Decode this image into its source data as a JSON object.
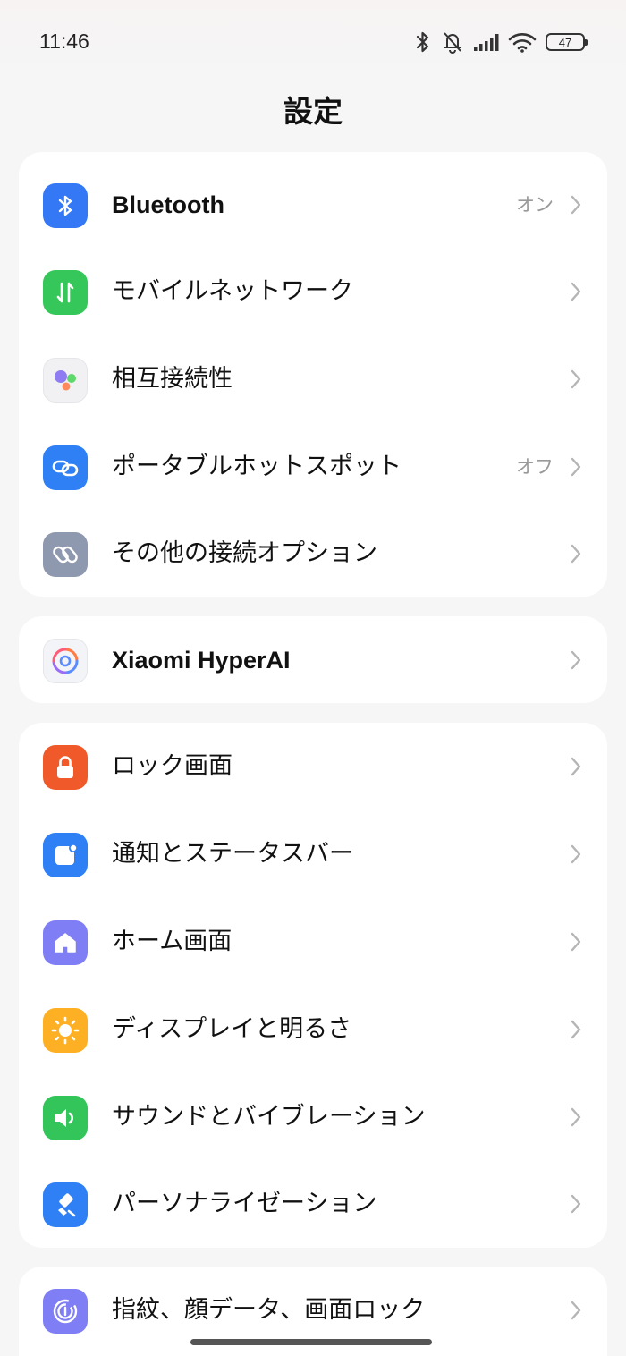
{
  "status_bar": {
    "time": "11:46",
    "battery": "47",
    "icons": [
      "bluetooth-icon",
      "muted-bell-icon",
      "signal-icon",
      "wifi-icon",
      "battery-icon"
    ]
  },
  "header": {
    "title": "設定"
  },
  "groups": [
    {
      "items": [
        {
          "label": "Bluetooth",
          "value": "オン",
          "icon": "bluetooth-icon",
          "icon_color": "#3478f6"
        },
        {
          "label": "モバイルネットワーク",
          "value": "",
          "icon": "mobile-data-icon",
          "icon_color": "#35c759"
        },
        {
          "label": "相互接続性",
          "value": "",
          "icon": "interconnectivity-icon",
          "icon_color": "#f1f1f3"
        },
        {
          "label": "ポータブルホットスポット",
          "value": "オフ",
          "icon": "hotspot-icon",
          "icon_color": "#2f80f5"
        },
        {
          "label": "その他の接続オプション",
          "value": "",
          "icon": "link-icon",
          "icon_color": "#8e98ae"
        }
      ]
    },
    {
      "items": [
        {
          "label": "Xiaomi HyperAI",
          "value": "",
          "icon": "hyperai-icon",
          "icon_color": "#f3f4f7"
        }
      ]
    },
    {
      "items": [
        {
          "label": "ロック画面",
          "value": "",
          "icon": "lock-icon",
          "icon_color": "#f05a2a"
        },
        {
          "label": "通知とステータスバー",
          "value": "",
          "icon": "notification-icon",
          "icon_color": "#2f80f5"
        },
        {
          "label": "ホーム画面",
          "value": "",
          "icon": "home-icon",
          "icon_color": "#7f7ef4"
        },
        {
          "label": "ディスプレイと明るさ",
          "value": "",
          "icon": "brightness-icon",
          "icon_color": "#fdb023"
        },
        {
          "label": "サウンドとバイブレーション",
          "value": "",
          "icon": "speaker-icon",
          "icon_color": "#33c45a"
        },
        {
          "label": "パーソナライゼーション",
          "value": "",
          "icon": "brush-icon",
          "icon_color": "#2f80f5"
        }
      ]
    },
    {
      "items": [
        {
          "label": "指紋、顔データ、画面ロック",
          "value": "",
          "icon": "fingerprint-icon",
          "icon_color": "#7f7ef4"
        }
      ]
    }
  ]
}
